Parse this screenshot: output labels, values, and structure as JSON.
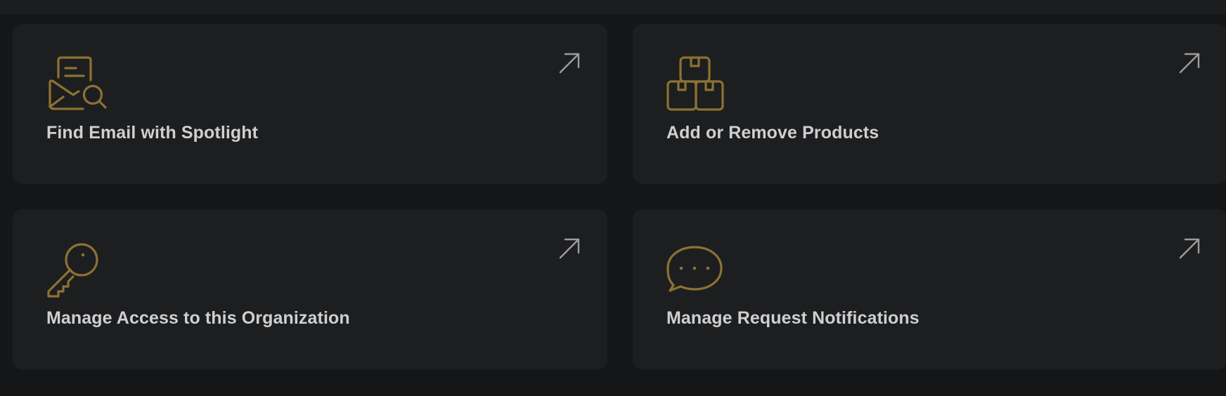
{
  "colors": {
    "page_background": "#151618",
    "card_background": "#1d1e20",
    "icon_gold": "#8c7232",
    "arrow_gray": "#9c9c9c",
    "title_text": "#cfcfcf"
  },
  "cards": [
    {
      "title": "Find Email with Spotlight",
      "icon": "email-search-icon",
      "link_icon": "arrow-up-right-icon"
    },
    {
      "title": "Add or Remove Products",
      "icon": "boxes-icon",
      "link_icon": "arrow-up-right-icon"
    },
    {
      "title": "Manage Access to this Organization",
      "icon": "key-icon",
      "link_icon": "arrow-up-right-icon"
    },
    {
      "title": "Manage Request Notifications",
      "icon": "chat-bubble-icon",
      "link_icon": "arrow-up-right-icon"
    }
  ]
}
